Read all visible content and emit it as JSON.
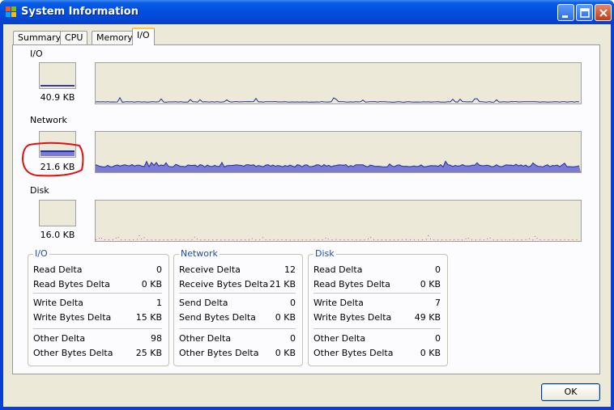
{
  "window": {
    "title": "System Information"
  },
  "tabs": [
    {
      "label": "Summary"
    },
    {
      "label": "CPU"
    },
    {
      "label": "Memory"
    },
    {
      "label": "I/O"
    }
  ],
  "graphs": {
    "io": {
      "label": "I/O",
      "value": "40.9  KB",
      "level": 0.05
    },
    "network": {
      "label": "Network",
      "value": "21.6  KB",
      "level": 0.22
    },
    "disk": {
      "label": "Disk",
      "value": "16.0  KB",
      "level": 0.0
    }
  },
  "colors": {
    "graph_line": "#1e2f9e",
    "graph_fill": "#7b7bd6",
    "disk_line": "#d040c0",
    "annotation": "#e01010"
  },
  "stats": {
    "io": {
      "title": "I/O",
      "rows": [
        {
          "label": "Read Delta",
          "value": "0"
        },
        {
          "label": "Read Bytes Delta",
          "value": "0 KB"
        },
        {
          "label": "Write Delta",
          "value": "1"
        },
        {
          "label": "Write Bytes Delta",
          "value": "15 KB"
        },
        {
          "label": "Other Delta",
          "value": "98"
        },
        {
          "label": "Other Bytes Delta",
          "value": "25 KB"
        }
      ]
    },
    "network": {
      "title": "Network",
      "rows": [
        {
          "label": "Receive Delta",
          "value": "12"
        },
        {
          "label": "Receive Bytes Delta",
          "value": "21 KB"
        },
        {
          "label": "Send Delta",
          "value": "0"
        },
        {
          "label": "Send Bytes Delta",
          "value": "0 KB"
        },
        {
          "label": "Other Delta",
          "value": "0"
        },
        {
          "label": "Other Bytes Delta",
          "value": "0 KB"
        }
      ]
    },
    "disk": {
      "title": "Disk",
      "rows": [
        {
          "label": "Read Delta",
          "value": "0"
        },
        {
          "label": "Read Bytes Delta",
          "value": "0 KB"
        },
        {
          "label": "Write Delta",
          "value": "7"
        },
        {
          "label": "Write Bytes Delta",
          "value": "49 KB"
        },
        {
          "label": "Other Delta",
          "value": "0"
        },
        {
          "label": "Other Bytes Delta",
          "value": "0 KB"
        }
      ]
    }
  },
  "buttons": {
    "ok_label": "OK"
  }
}
